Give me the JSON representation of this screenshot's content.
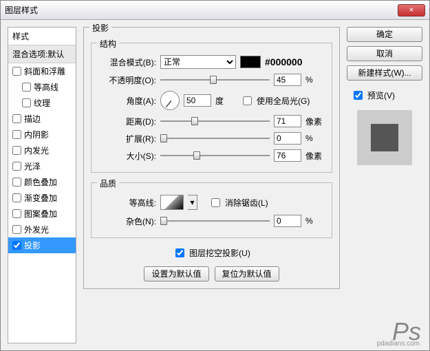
{
  "window": {
    "title": "图层样式"
  },
  "close": "×",
  "left": {
    "header": "样式",
    "subheader": "混合选项:默认",
    "items": [
      {
        "label": "斜面和浮雕",
        "checked": false,
        "indent": false
      },
      {
        "label": "等高线",
        "checked": false,
        "indent": true
      },
      {
        "label": "纹理",
        "checked": false,
        "indent": true
      },
      {
        "label": "描边",
        "checked": false,
        "indent": false
      },
      {
        "label": "内阴影",
        "checked": false,
        "indent": false
      },
      {
        "label": "内发光",
        "checked": false,
        "indent": false
      },
      {
        "label": "光泽",
        "checked": false,
        "indent": false
      },
      {
        "label": "颜色叠加",
        "checked": false,
        "indent": false
      },
      {
        "label": "渐变叠加",
        "checked": false,
        "indent": false
      },
      {
        "label": "图案叠加",
        "checked": false,
        "indent": false
      },
      {
        "label": "外发光",
        "checked": false,
        "indent": false
      },
      {
        "label": "投影",
        "checked": true,
        "indent": false
      }
    ]
  },
  "center": {
    "title": "投影",
    "structure": {
      "title": "结构",
      "blend_label": "混合模式(B):",
      "blend_value": "正常",
      "hex": "#000000",
      "opacity_label": "不透明度(O):",
      "opacity_value": "45",
      "opacity_unit": "%",
      "angle_label": "角度(A):",
      "angle_value": "50",
      "angle_unit": "度",
      "global_light": "使用全局光(G)",
      "distance_label": "距离(D):",
      "distance_value": "71",
      "distance_unit": "像素",
      "spread_label": "扩展(R):",
      "spread_value": "0",
      "spread_unit": "%",
      "size_label": "大小(S):",
      "size_value": "76",
      "size_unit": "像素"
    },
    "quality": {
      "title": "品质",
      "contour_label": "等高线:",
      "antialias": "消除锯齿(L)",
      "noise_label": "杂色(N):",
      "noise_value": "0",
      "noise_unit": "%"
    },
    "knockout": "图层挖空投影(U)",
    "btn_default": "设置为默认值",
    "btn_reset": "复位为默认值"
  },
  "right": {
    "ok": "确定",
    "cancel": "取消",
    "newstyle": "新建样式(W)...",
    "preview": "预览(V)"
  },
  "watermark": {
    "logo": "Ps",
    "url": "pdadians.com"
  }
}
